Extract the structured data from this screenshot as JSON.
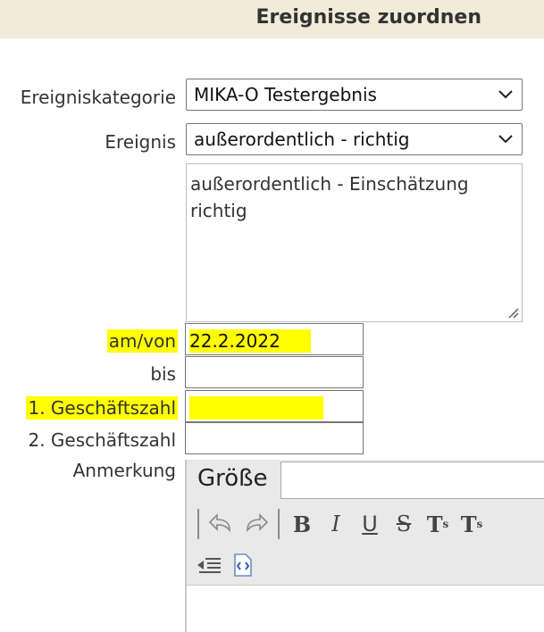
{
  "header": {
    "title": "Ereignisse zuordnen"
  },
  "form": {
    "category": {
      "label": "Ereigniskategorie",
      "value": "MIKA-O Testergebnis"
    },
    "event": {
      "label": "Ereignis",
      "value": "außerordentlich - richtig"
    },
    "description": {
      "line1": "außerordentlich - Einschätzung",
      "line2": "richtig"
    },
    "date_from": {
      "label": "am/von",
      "value": "22.2.2022"
    },
    "date_to": {
      "label": "bis",
      "value": ""
    },
    "ref1": {
      "label": "1. Geschäftszahl",
      "value": ""
    },
    "ref2": {
      "label": "2. Geschäftszahl",
      "value": ""
    },
    "remark": {
      "label": "Anmerkung"
    }
  },
  "editor": {
    "size_label": "Größe",
    "size_value": "",
    "icons": [
      "undo-icon",
      "redo-icon",
      "bold-icon",
      "italic-icon",
      "underline-icon",
      "strikethrough-icon",
      "subscript-icon",
      "superscript-icon",
      "outdent-icon",
      "source-icon"
    ]
  },
  "colors": {
    "header_bg": "#f2ebd9",
    "highlight": "#ffff00"
  }
}
